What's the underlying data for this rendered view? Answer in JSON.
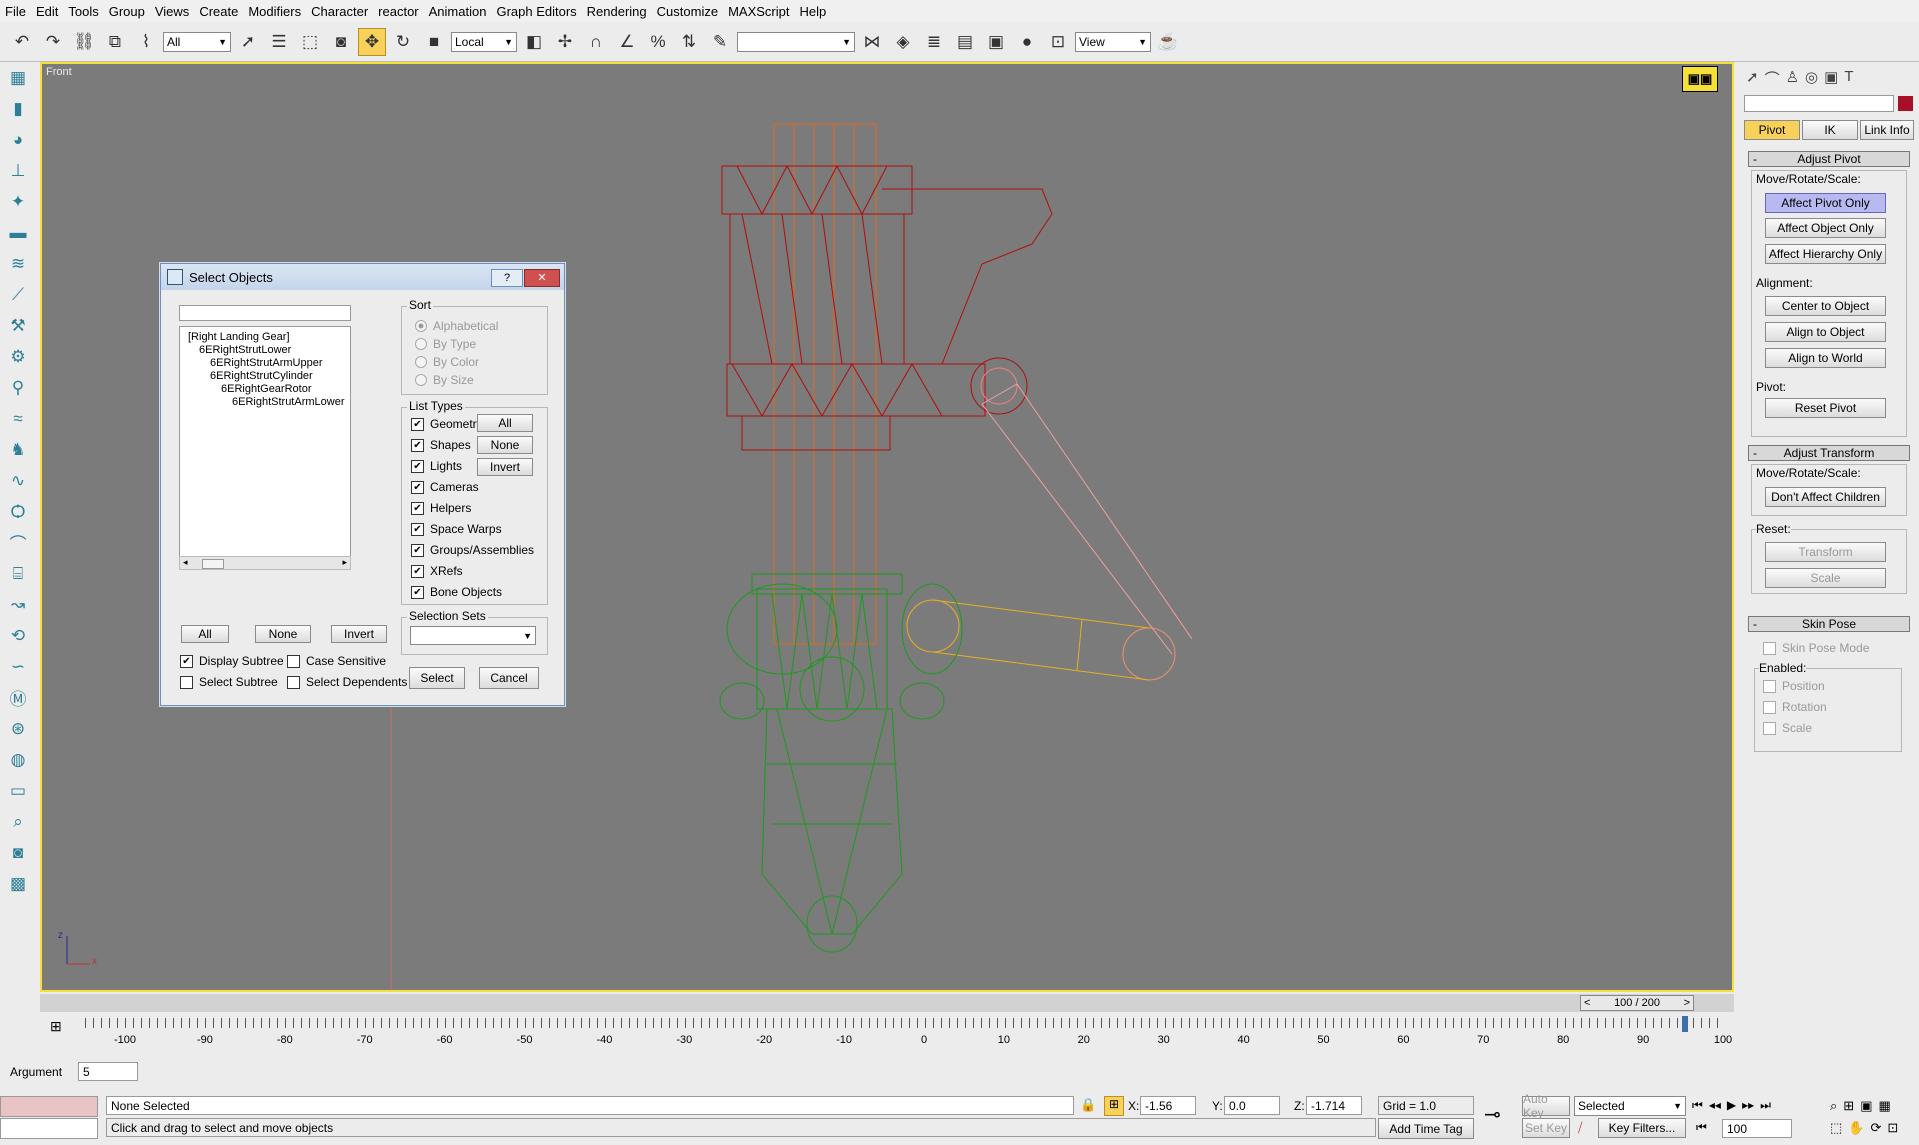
{
  "menu": [
    "File",
    "Edit",
    "Tools",
    "Group",
    "Views",
    "Create",
    "Modifiers",
    "Character",
    "reactor",
    "Animation",
    "Graph Editors",
    "Rendering",
    "Customize",
    "MAXScript",
    "Help"
  ],
  "toolbar": {
    "selection_filter": "All",
    "ref_coord": "Local",
    "named_selection": "",
    "view_combo": "View"
  },
  "viewport": {
    "label": "Front",
    "axis_z": "z",
    "axis_x": "x",
    "colors": {
      "strut_upper": "#c01010",
      "strut_cyl": "#e06a1e",
      "gear": "#1e9a1e",
      "arm": "#e6b020",
      "arm_lower": "#f08080"
    }
  },
  "dialog": {
    "title": "Select Objects",
    "help": "?",
    "close": "✕",
    "filter_input": "",
    "tree": [
      {
        "label": "[Right Landing Gear]",
        "indent": 0
      },
      {
        "label": "6ERightStrutLower",
        "indent": 1
      },
      {
        "label": "6ERightStrutArmUpper",
        "indent": 2
      },
      {
        "label": "6ERightStrutCylinder",
        "indent": 2
      },
      {
        "label": "6ERightGearRotor",
        "indent": 3
      },
      {
        "label": "6ERightStrutArmLower",
        "indent": 4
      }
    ],
    "buttons": {
      "all": "All",
      "none": "None",
      "invert": "Invert",
      "select": "Select",
      "cancel": "Cancel"
    },
    "sort": {
      "label": "Sort",
      "options": [
        "Alphabetical",
        "By Type",
        "By Color",
        "By Size"
      ]
    },
    "list_types": {
      "label": "List Types",
      "items": [
        "Geometry",
        "Shapes",
        "Lights",
        "Cameras",
        "Helpers",
        "Space Warps",
        "Groups/Assemblies",
        "XRefs",
        "Bone Objects"
      ],
      "all": "All",
      "none": "None",
      "invert": "Invert"
    },
    "selection_sets": {
      "label": "Selection Sets",
      "value": ""
    },
    "options": {
      "display_subtree": "Display Subtree",
      "case_sensitive": "Case Sensitive",
      "select_subtree": "Select Subtree",
      "select_dependents": "Select Dependents"
    }
  },
  "cmdpanel": {
    "name_field": "",
    "tabs": [
      "Pivot",
      "IK",
      "Link Info"
    ],
    "adjust_pivot": {
      "title": "Adjust Pivot",
      "move_label": "Move/Rotate/Scale:",
      "affect_pivot": "Affect Pivot Only",
      "affect_object": "Affect Object Only",
      "affect_hierarchy": "Affect Hierarchy Only",
      "alignment_label": "Alignment:",
      "center": "Center to Object",
      "align_object": "Align to Object",
      "align_world": "Align to World",
      "pivot_label": "Pivot:",
      "reset_pivot": "Reset Pivot"
    },
    "adjust_transform": {
      "title": "Adjust Transform",
      "move_label": "Move/Rotate/Scale:",
      "dont_affect": "Don't Affect Children",
      "reset_label": "Reset:",
      "transform": "Transform",
      "scale": "Scale"
    },
    "skin_pose": {
      "title": "Skin Pose",
      "mode": "Skin Pose Mode",
      "enabled_label": "Enabled:",
      "position": "Position",
      "rotation": "Rotation",
      "scale": "Scale"
    }
  },
  "timeline": {
    "frame_display": "100 / 200",
    "ticks": [
      "-100",
      "-90",
      "-80",
      "-70",
      "-60",
      "-50",
      "-40",
      "-30",
      "-20",
      "-10",
      "0",
      "10",
      "20",
      "30",
      "40",
      "50",
      "60",
      "70",
      "80",
      "90",
      "100"
    ]
  },
  "status": {
    "argument_label": "Argument",
    "argument_value": "5",
    "selection": "None Selected",
    "prompt": "Click and drag to select and move objects",
    "x_label": "X:",
    "x_value": "-1.56",
    "y_label": "Y:",
    "y_value": "0.0",
    "z_label": "Z:",
    "z_value": "-1.714",
    "grid": "Grid = 1.0",
    "add_time_tag": "Add Time Tag",
    "auto_key": "Auto Key",
    "set_key": "Set Key",
    "selected_combo": "Selected",
    "key_filters": "Key Filters...",
    "frame": "100"
  }
}
